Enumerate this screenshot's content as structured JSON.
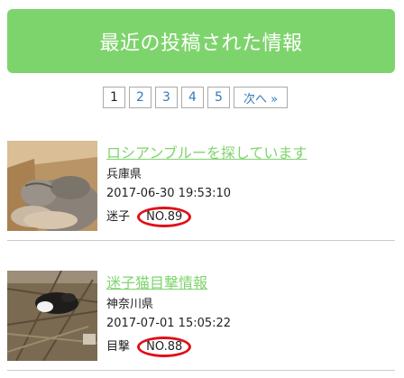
{
  "header": {
    "title": "最近の投稿された情報"
  },
  "pagination": {
    "pages": [
      "1",
      "2",
      "3",
      "4",
      "5"
    ],
    "current": "1",
    "next_label": "次へ »"
  },
  "posts": [
    {
      "title": "ロシアンブルーを探しています",
      "prefecture": "兵庫県",
      "datetime": "2017-06-30 19:53:10",
      "category": "迷子",
      "number": "NO.89"
    },
    {
      "title": "迷子猫目撃情報",
      "prefecture": "神奈川県",
      "datetime": "2017-07-01 15:05:22",
      "category": "目撃",
      "number": "NO.88"
    }
  ],
  "colors": {
    "accent": "#7ed46c",
    "link": "#337ab7",
    "highlight": "#e0101a"
  }
}
